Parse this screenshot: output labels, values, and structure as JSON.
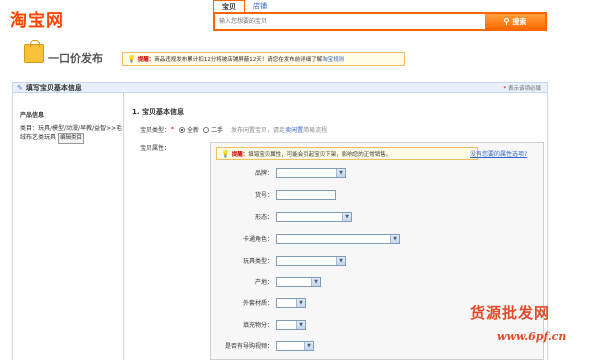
{
  "header": {
    "logo": "淘宝网",
    "tabs": [
      "宝贝",
      "店铺"
    ],
    "search_placeholder": "输入您想要的宝贝",
    "search_button": "搜索"
  },
  "banner": {
    "title": "一口价发布",
    "notice_label": "提醒：",
    "notice_text": "商品违规发布累计扣12分将被店铺屏蔽12天！请您在发布前详细了解",
    "notice_link": "淘宝规则"
  },
  "section": {
    "title": "填写宝贝基本信息",
    "required_hint": "表示该项必填"
  },
  "left": {
    "title": "产品信息",
    "category_prefix": "类目：玩具/模型/动漫/早教/益智>>毛绒布艺类玩具",
    "edit_button": "编辑类目"
  },
  "main": {
    "title": "1. 宝贝基本信息",
    "type_label": "宝贝类型：",
    "type_new": "全新",
    "type_used": "二手",
    "type_hint": "发布闲置宝贝，请走",
    "type_hint_link": "卖闲置",
    "type_hint_tail": "简易流程",
    "attr_label": "宝贝属性：",
    "attr_notice_label": "提醒：",
    "attr_notice_text": "填错宝贝属性，可能会引起宝贝下架，影响您的正常销售。",
    "suggest_link": "没有您要的属性选项?",
    "fields": [
      {
        "label": "品牌："
      },
      {
        "label": "货号："
      },
      {
        "label": "形态："
      },
      {
        "label": "卡通角色："
      },
      {
        "label": "玩具类型："
      },
      {
        "label": "产地："
      },
      {
        "label": "外套材质："
      },
      {
        "label": "填充物分："
      },
      {
        "label": "是否有导购视频："
      }
    ]
  },
  "watermark": {
    "line1": "货源批发网",
    "line2": "www.6pf.cn"
  }
}
